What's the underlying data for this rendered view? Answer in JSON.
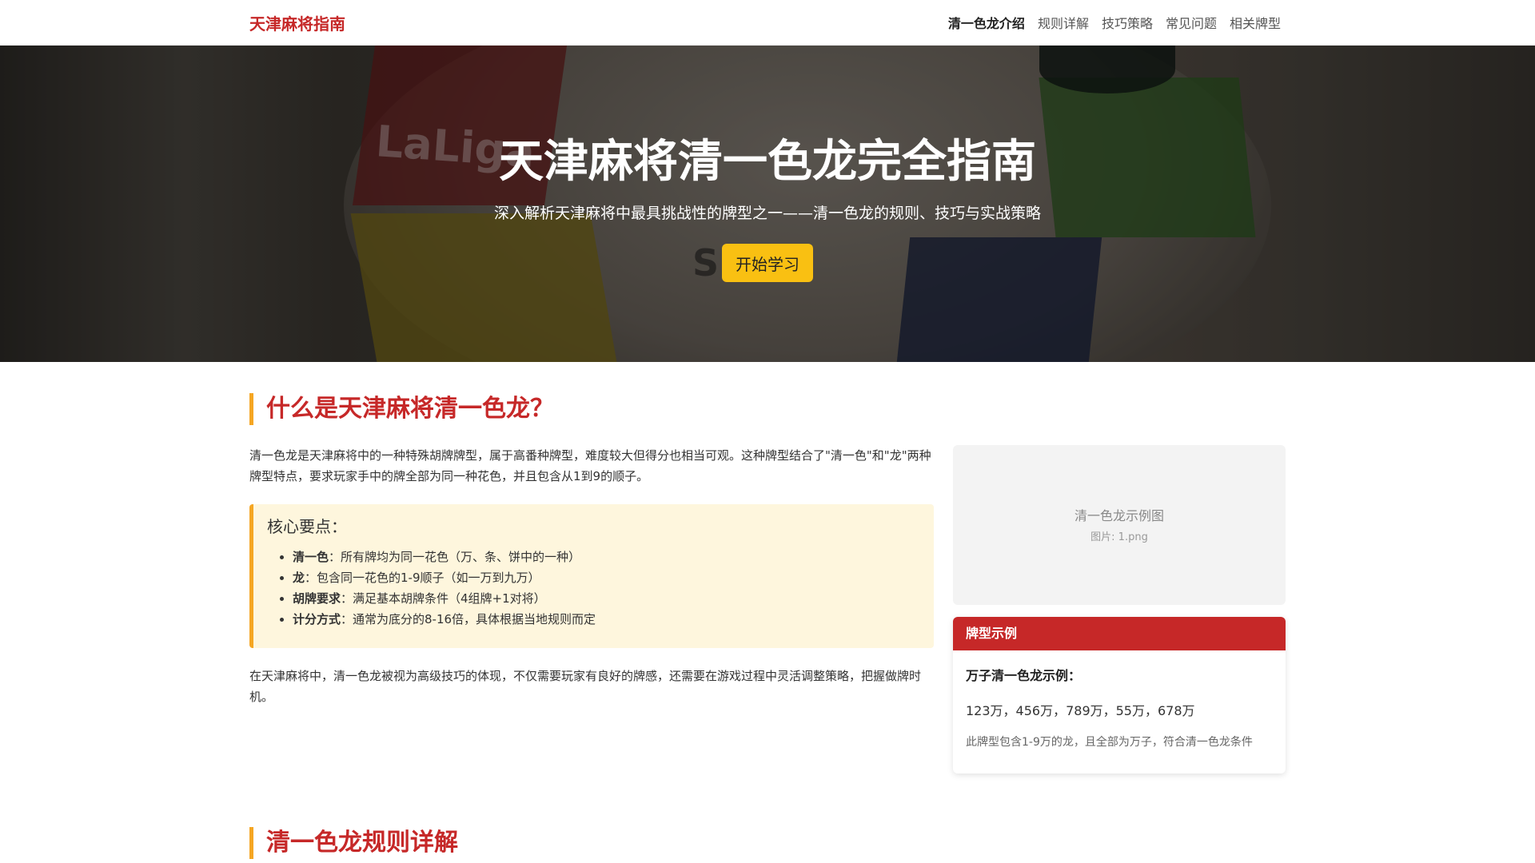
{
  "nav": {
    "brand": "天津麻将指南",
    "links": [
      {
        "label": "清一色龙介绍"
      },
      {
        "label": "规则详解"
      },
      {
        "label": "技巧策略"
      },
      {
        "label": "常见问题"
      },
      {
        "label": "相关牌型"
      }
    ]
  },
  "hero": {
    "title": "天津麻将清一色龙完全指南",
    "subtitle": "深入解析天津麻将中最具挑战性的牌型之一——清一色龙的规则、技巧与实战策略",
    "cta": "开始学习",
    "bg_logo_text": "LaLiga",
    "bg_sponsor_text": "SEDA"
  },
  "intro": {
    "title": "什么是天津麻将清一色龙？",
    "paragraph": "清一色龙是天津麻将中的一种特殊胡牌牌型，属于高番种牌型，难度较大但得分也相当可观。这种牌型结合了\"清一色\"和\"龙\"两种牌型特点，要求玩家手中的牌全部为同一种花色，并且包含从1到9的顺子。",
    "keypoints": {
      "title": "核心要点：",
      "items": [
        {
          "term": "清一色",
          "desc": "：所有牌均为同一花色（万、条、饼中的一种）"
        },
        {
          "term": "龙",
          "desc": "：包含同一花色的1-9顺子（如一万到九万）"
        },
        {
          "term": "胡牌要求",
          "desc": "：满足基本胡牌条件（4组牌+1对将）"
        },
        {
          "term": "计分方式",
          "desc": "：通常为底分的8-16倍，具体根据当地规则而定"
        }
      ]
    },
    "outro": "在天津麻将中，清一色龙被视为高级技巧的体现，不仅需要玩家有良好的牌感，还需要在游戏过程中灵活调整策略，把握做牌时机。"
  },
  "image": {
    "caption": "清一色龙示例图",
    "filename": "图片: 1.png"
  },
  "example_card": {
    "header": "牌型示例",
    "title": "万子清一色龙示例：",
    "tiles": "123万，456万，789万，55万，678万",
    "note": "此牌型包含1-9万的龙，且全部为万子，符合清一色龙条件"
  },
  "rules": {
    "title": "清一色龙规则详解"
  },
  "colors": {
    "brand_red": "#c62828",
    "accent_yellow": "#f9c012",
    "accent_orange": "#f5a623",
    "keypoint_bg": "#fef6dd"
  }
}
